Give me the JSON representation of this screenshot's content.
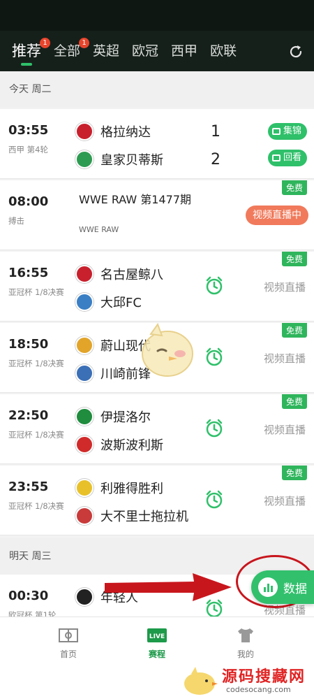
{
  "tabs": [
    {
      "label": "推荐",
      "badge": "1",
      "active": true
    },
    {
      "label": "全部",
      "badge": "1"
    },
    {
      "label": "英超"
    },
    {
      "label": "欧冠"
    },
    {
      "label": "西甲"
    },
    {
      "label": "欧联"
    }
  ],
  "days": [
    {
      "label": "今天 周二"
    },
    {
      "label": "明天 周三"
    }
  ],
  "matches": [
    {
      "time": "03:55",
      "league": "西甲 第4轮",
      "home": "格拉纳达",
      "away": "皇家贝蒂斯",
      "home_score": "1",
      "away_score": "2",
      "btn1": "集锦",
      "btn2": "回看"
    },
    {
      "time": "08:00",
      "league": "搏击",
      "title": "WWE RAW 第1477期",
      "subtitle": "WWE RAW",
      "free": "免费",
      "status": "视频直播中"
    },
    {
      "time": "16:55",
      "league": "亚冠杯 1/8决赛",
      "home": "名古屋鲸八",
      "away": "大邱FC",
      "free": "免费",
      "status": "视频直播"
    },
    {
      "time": "18:50",
      "league": "亚冠杯 1/8决赛",
      "home": "蔚山现代",
      "away": "川崎前锋",
      "free": "免费",
      "status": "视频直播"
    },
    {
      "time": "22:50",
      "league": "亚冠杯 1/8决赛",
      "home": "伊提洛尔",
      "away": "波斯波利斯",
      "free": "免费",
      "status": "视频直播"
    },
    {
      "time": "23:55",
      "league": "亚冠杯 1/8决赛",
      "home": "利雅得胜利",
      "away": "大不里士拖拉机",
      "free": "免费",
      "status": "视频直播"
    },
    {
      "time": "00:30",
      "league": "欧冠杯 第1轮",
      "home": "年轻人",
      "status": "视频直播"
    }
  ],
  "fab": {
    "label": "数据"
  },
  "bottom_nav": [
    {
      "label": "首页"
    },
    {
      "label": "赛程",
      "active": true,
      "icon_text": "LIVE"
    },
    {
      "label": "我的"
    }
  ],
  "watermark": {
    "title": "源码搜藏网",
    "sub": "codesocang.com"
  },
  "colors": {
    "accent": "#2fc06a",
    "live_pill": "#f07a5b",
    "badge": "#e8452c",
    "annotation": "#c8161d"
  }
}
